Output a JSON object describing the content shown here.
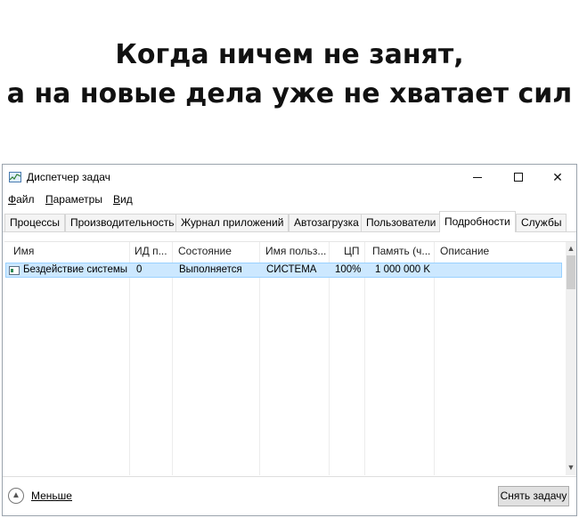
{
  "caption": {
    "line1": "Когда ничем не занят,",
    "line2": "а на новые дела уже не хватает сил"
  },
  "window": {
    "title": "Диспетчер задач",
    "icons": {
      "app": "task-manager-icon",
      "minimize": "minimize-icon",
      "maximize": "maximize-icon",
      "close": "close-icon"
    },
    "close_glyph": "✕"
  },
  "menu": [
    {
      "first": "Ф",
      "rest": "айл"
    },
    {
      "first": "П",
      "rest": "араметры"
    },
    {
      "first": "В",
      "rest": "ид"
    }
  ],
  "tabs": [
    "Процессы",
    "Производительность",
    "Журнал приложений",
    "Автозагрузка",
    "Пользователи",
    "Подробности",
    "Службы"
  ],
  "active_tab": "Подробности",
  "table": {
    "columns": [
      "Имя",
      "ИД п...",
      "Состояние",
      "Имя польз...",
      "ЦП",
      "Память (ч...",
      "Описание"
    ],
    "rows": [
      {
        "name": "Бездействие системы",
        "pid": "0",
        "status": "Выполняется",
        "user": "СИСТЕМА",
        "cpu": "100%",
        "memory": "1 000 000 K",
        "description": ""
      }
    ]
  },
  "footer": {
    "fewer_label": "Меньше",
    "end_task_label": "Снять задачу"
  }
}
